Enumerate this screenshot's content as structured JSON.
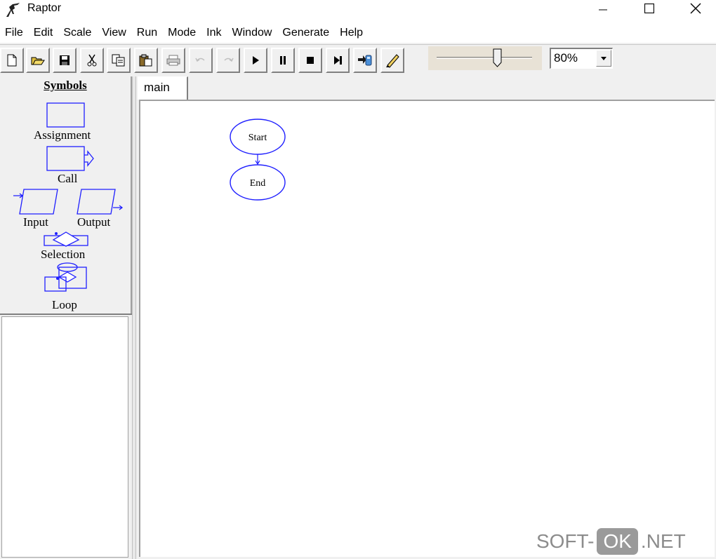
{
  "window": {
    "title": "Raptor"
  },
  "menu": [
    "File",
    "Edit",
    "Scale",
    "View",
    "Run",
    "Mode",
    "Ink",
    "Window",
    "Generate",
    "Help"
  ],
  "toolbar": {
    "buttons": [
      "new-file",
      "open-folder",
      "save",
      "cut",
      "copy",
      "paste",
      "print",
      "undo",
      "redo",
      "run",
      "pause",
      "stop",
      "step",
      "generate",
      "ink-pen"
    ],
    "zoom": "80%",
    "slider_fraction": 0.64
  },
  "symbols": {
    "title": "Symbols",
    "assignment": "Assignment",
    "call": "Call",
    "input": "Input",
    "output": "Output",
    "selection": "Selection",
    "loop": "Loop"
  },
  "tabs": [
    {
      "label": "main"
    }
  ],
  "flowchart": {
    "start": "Start",
    "end": "End"
  },
  "colors": {
    "symbol_blue": "#1f1fff"
  },
  "watermark": {
    "left": "SOFT-",
    "mid": "OK",
    "right": ".NET"
  }
}
